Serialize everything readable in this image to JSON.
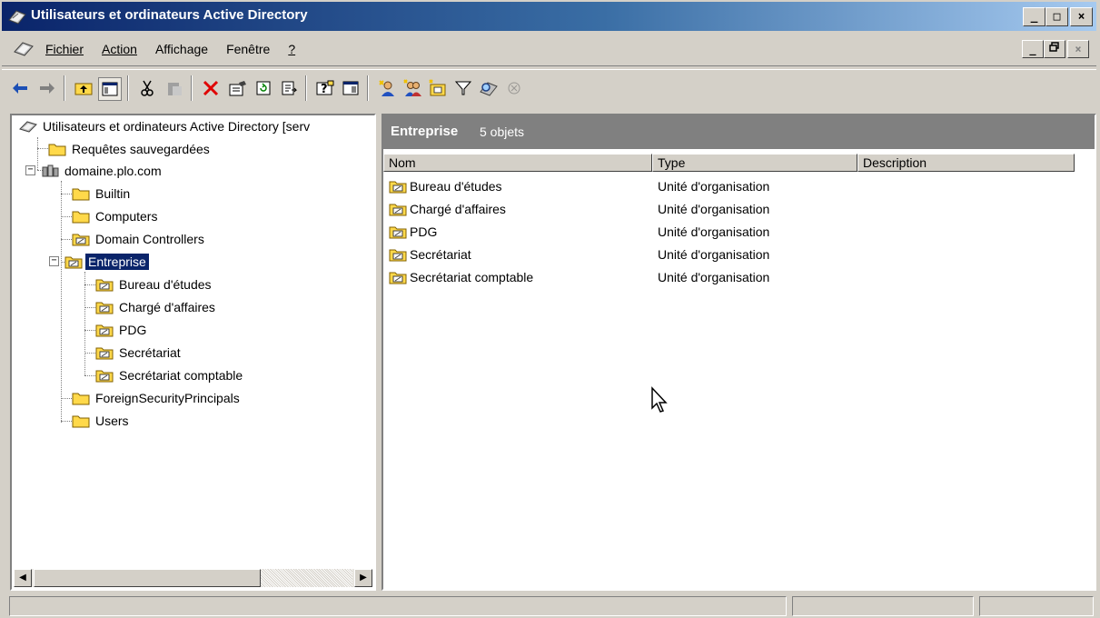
{
  "window": {
    "title": "Utilisateurs et ordinateurs Active Directory",
    "caption_buttons": [
      "_",
      "□",
      "×"
    ],
    "mdi_buttons": [
      "_",
      "\u0002",
      "×"
    ]
  },
  "menu": {
    "items": [
      "Fichier",
      "Action",
      "Affichage",
      "Fenêtre",
      "?"
    ]
  },
  "toolbar": {
    "icons": [
      "back-arrow-icon",
      "forward-arrow-icon",
      "up-folder-icon",
      "show-hide-tree-icon",
      "cut-icon",
      "paste-icon",
      "delete-icon",
      "properties-icon",
      "refresh-icon",
      "export-list-icon",
      "help-icon",
      "console-tree-icon",
      "create-user-icon",
      "create-group-icon",
      "create-ou-icon",
      "filter-icon",
      "find-icon",
      "add-to-group-icon"
    ]
  },
  "tree": {
    "root": "Utilisateurs et ordinateurs Active Directory [serv",
    "saved_queries": "Requêtes sauvegardées",
    "domain": "domaine.plo.com",
    "builtin": "Builtin",
    "computers": "Computers",
    "domain_controllers": "Domain Controllers",
    "entreprise": "Entreprise",
    "children": [
      "Bureau d'études",
      "Chargé d'affaires",
      "PDG",
      "Secrétariat",
      "Secrétariat comptable"
    ],
    "foreign": "ForeignSecurityPrincipals",
    "users": "Users"
  },
  "details": {
    "header_title": "Entreprise",
    "header_count": "5 objets",
    "columns": [
      "Nom",
      "Type",
      "Description"
    ],
    "rows": [
      {
        "name": "Bureau d'études",
        "type": "Unité d'organisation",
        "description": ""
      },
      {
        "name": "Chargé d'affaires",
        "type": "Unité d'organisation",
        "description": ""
      },
      {
        "name": "PDG",
        "type": "Unité d'organisation",
        "description": ""
      },
      {
        "name": "Secrétariat",
        "type": "Unité d'organisation",
        "description": ""
      },
      {
        "name": "Secrétariat comptable",
        "type": "Unité d'organisation",
        "description": ""
      }
    ]
  },
  "colors": {
    "title_gradient_start": "#0a246a",
    "title_gradient_end": "#a6caf0",
    "selection": "#0a246a",
    "details_header": "#808080",
    "folder_yellow": "#ffd94a",
    "face": "#d4d0c8"
  }
}
